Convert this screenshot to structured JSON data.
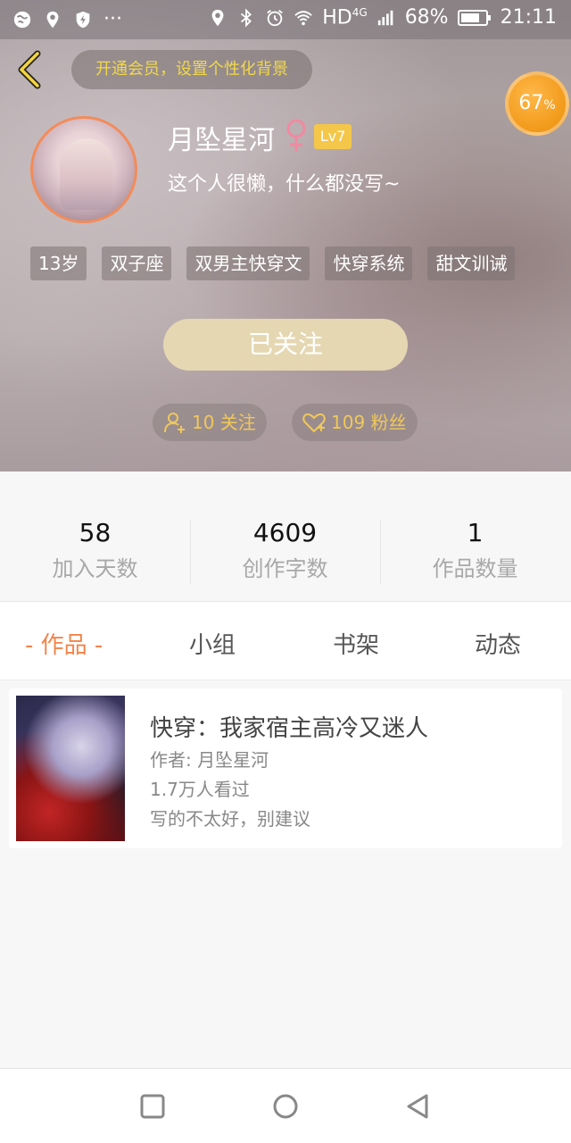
{
  "status_bar": {
    "network": "HD",
    "network_sup": "4G",
    "battery": "68%",
    "time": "21:11",
    "icons": [
      "globe-icon",
      "location-icon",
      "shield-icon",
      "more-icon",
      "location-icon",
      "bluetooth-icon",
      "alarm-icon",
      "wifi-icon",
      "signal-icon",
      "battery-icon"
    ]
  },
  "header": {
    "vip_banner": "开通会员，设置个性化背景",
    "progress": "67",
    "progress_unit": "%",
    "username": "月坠星河",
    "level": "Lv7",
    "bio": "这个人很懒，什么都没写~",
    "tags": [
      "13岁",
      "双子座",
      "双男主快穿文",
      "快穿系统",
      "甜文训诫"
    ],
    "follow_button": "已关注",
    "following": "10 关注",
    "fans": "109 粉丝"
  },
  "stats": [
    {
      "value": "58",
      "label": "加入天数"
    },
    {
      "value": "4609",
      "label": "创作字数"
    },
    {
      "value": "1",
      "label": "作品数量"
    }
  ],
  "tabs": [
    "- 作品 -",
    "小组",
    "书架",
    "动态"
  ],
  "works": [
    {
      "title": "快穿：我家宿主高冷又迷人",
      "author": "作者: 月坠星河",
      "views": "1.7万人看过",
      "desc": "写的不太好，别建议"
    }
  ],
  "colors": {
    "accent": "#f2844a",
    "gold": "#f0c85a",
    "level_badge": "#f4c74a",
    "follow_button": "#e4d7b2",
    "female": "#f08aa0"
  }
}
